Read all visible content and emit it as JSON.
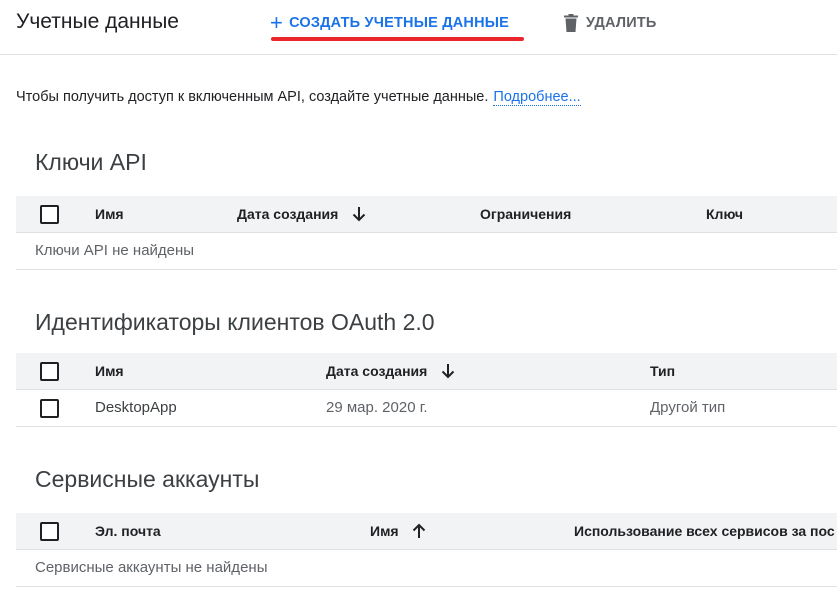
{
  "header": {
    "title": "Учетные данные",
    "create_label": "СОЗДАТЬ УЧЕТНЫЕ ДАННЫЕ",
    "create_icon": "plus-icon",
    "delete_label": "УДАЛИТЬ",
    "delete_icon": "trash-icon",
    "accent": "#1a73e8",
    "highlight": "#e8262c"
  },
  "info": {
    "text": "Чтобы получить доступ к включенным API, создайте учетные данные.",
    "link": "Подробнее..."
  },
  "api_keys": {
    "title": "Ключи API",
    "columns": [
      "Имя",
      "Дата создания",
      "Ограничения",
      "Ключ"
    ],
    "sort_icon": "arrow-down-icon",
    "empty": "Ключи API не найдены"
  },
  "oauth": {
    "title": "Идентификаторы клиентов OAuth 2.0",
    "columns": [
      "Имя",
      "Дата создания",
      "Тип"
    ],
    "sort_icon": "arrow-down-icon",
    "rows": [
      {
        "name": "DesktopApp",
        "date": "29 мар. 2020 г.",
        "type": "Другой тип"
      }
    ]
  },
  "service_accounts": {
    "title": "Сервисные аккаунты",
    "columns": [
      "Эл. почта",
      "Имя",
      "Использование всех сервисов за пос"
    ],
    "sort_icon": "arrow-up-icon",
    "empty": "Сервисные аккаунты не найдены"
  }
}
